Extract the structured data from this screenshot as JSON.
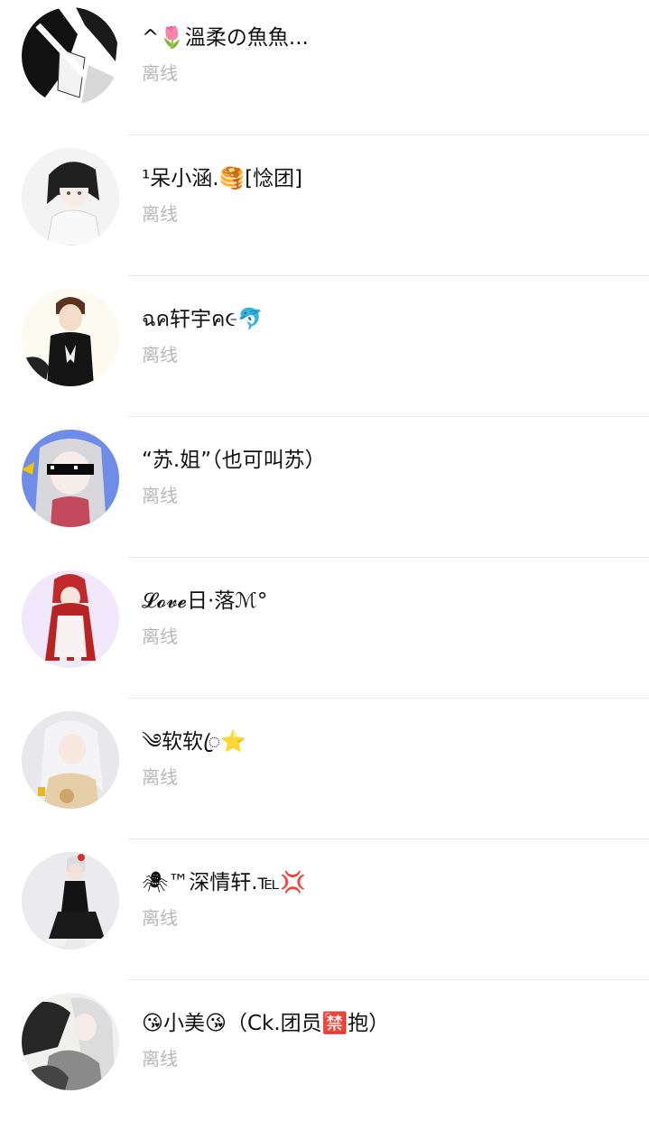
{
  "contacts": [
    {
      "name": "^🌷溫柔の魚魚...",
      "status": "离线",
      "avatar": "avatar-black-white-sketch"
    },
    {
      "name": "¹呆小涵.🥞[惗团]",
      "status": "离线",
      "avatar": "avatar-anime-girl-dark-hair"
    },
    {
      "name": "ฉค轩宇ค૯🐬",
      "status": "离线",
      "avatar": "avatar-anime-boy-black-shirt"
    },
    {
      "name": "“苏.姐”（也可叫苏）",
      "status": "离线",
      "avatar": "avatar-anime-girl-pixel-glasses"
    },
    {
      "name": "𝓛𝓸𝓿𝓮日·落ℳ°",
      "status": "离线",
      "avatar": "avatar-anime-girl-red-hood"
    },
    {
      "name": "༄软软ꦿ⭐",
      "status": "离线",
      "avatar": "avatar-anime-girl-silver-hair"
    },
    {
      "name": "🕷™深情轩.℡💢",
      "status": "离线",
      "avatar": "avatar-anime-figure-black-outfit"
    },
    {
      "name": "😘小美😘（Ck.团员🈲抱）",
      "status": "离线",
      "avatar": "avatar-anime-girl-monochrome"
    }
  ]
}
